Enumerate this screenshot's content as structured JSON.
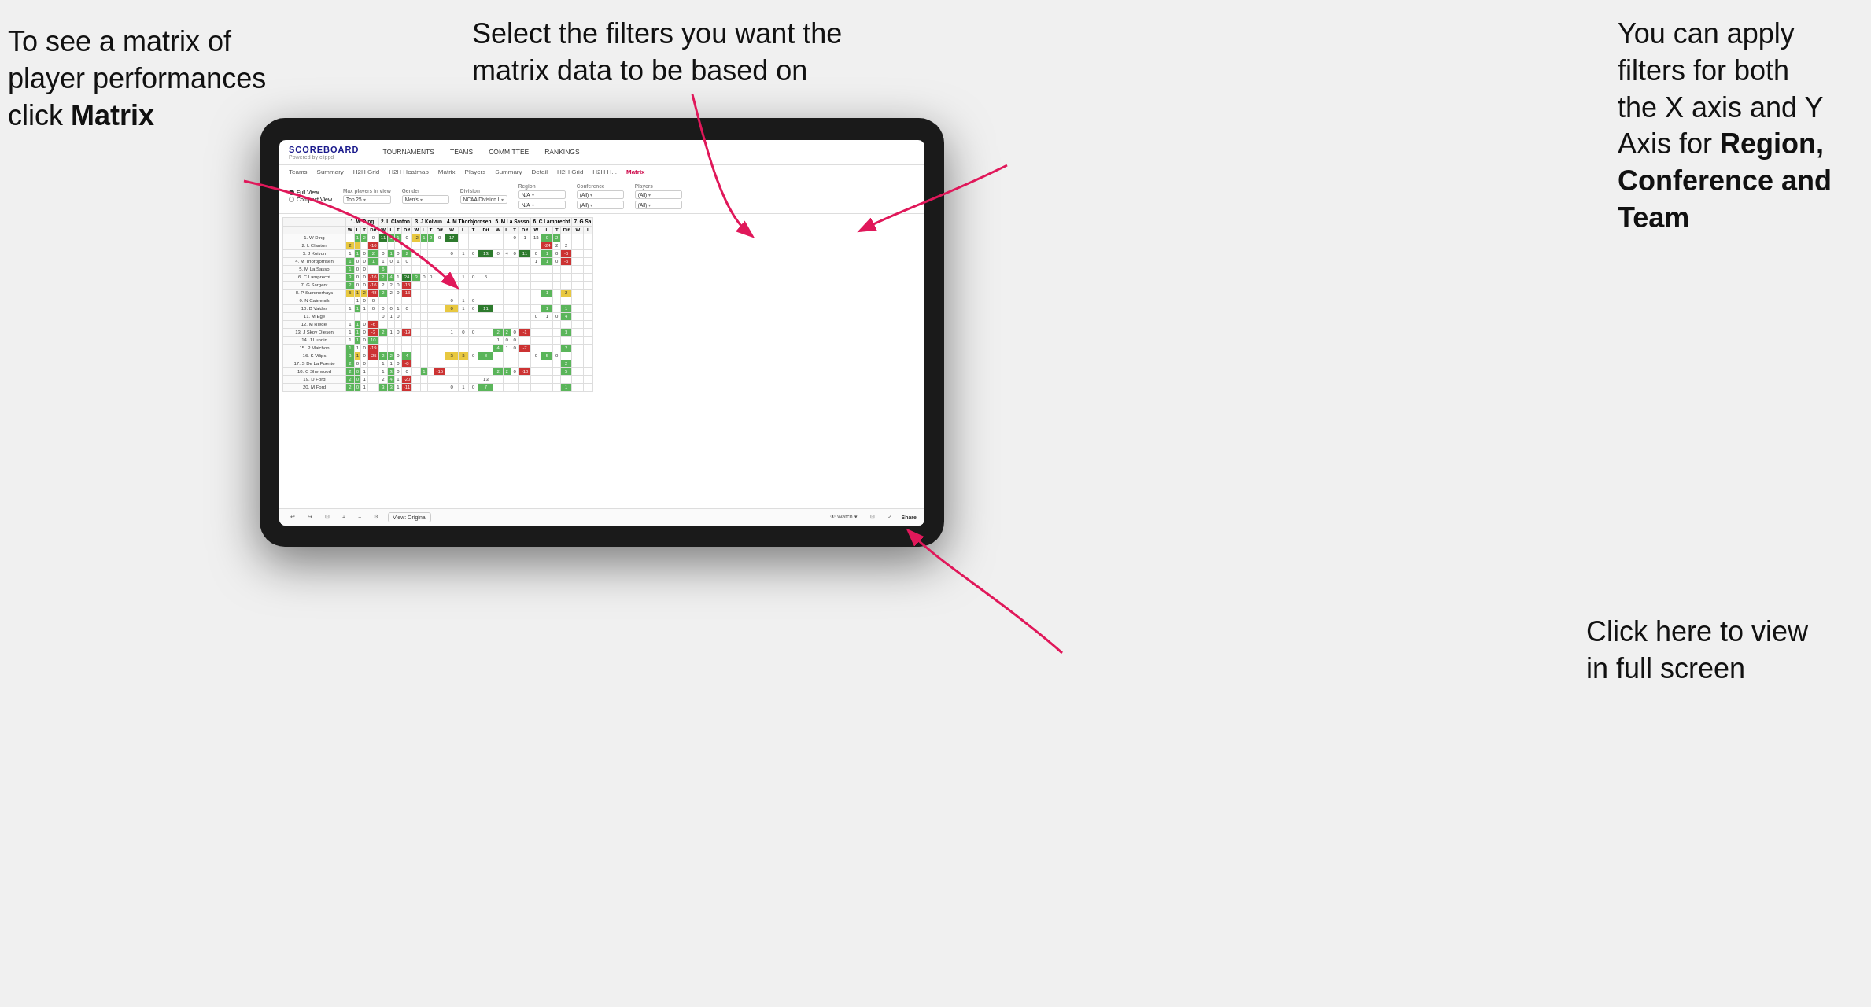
{
  "annotations": {
    "top_left": {
      "line1": "To see a matrix of",
      "line2": "player performances",
      "line3_normal": "click ",
      "line3_bold": "Matrix"
    },
    "top_center": {
      "text": "Select the filters you want the matrix data to be based on"
    },
    "top_right": {
      "line1": "You  can apply",
      "line2": "filters for both",
      "line3": "the X axis and Y",
      "line4_normal": "Axis for ",
      "line4_bold": "Region,",
      "line5_bold": "Conference and",
      "line6_bold": "Team"
    },
    "bottom_right": {
      "line1": "Click here to view",
      "line2": "in full screen"
    }
  },
  "nav": {
    "logo": "SCOREBOARD",
    "logo_sub": "Powered by clippd",
    "items": [
      "TOURNAMENTS",
      "TEAMS",
      "COMMITTEE",
      "RANKINGS"
    ]
  },
  "sub_nav": {
    "items": [
      "Teams",
      "Summary",
      "H2H Grid",
      "H2H Heatmap",
      "Matrix",
      "Players",
      "Summary",
      "Detail",
      "H2H Grid",
      "H2H H...",
      "Matrix"
    ]
  },
  "filters": {
    "view_options": [
      "Full View",
      "Compact View"
    ],
    "max_players_label": "Max players in view",
    "max_players_value": "Top 25",
    "gender_label": "Gender",
    "gender_value": "Men's",
    "division_label": "Division",
    "division_value": "NCAA Division I",
    "region_label": "Region",
    "region_value1": "N/A",
    "region_value2": "N/A",
    "conference_label": "Conference",
    "conference_value1": "(All)",
    "conference_value2": "(All)",
    "players_label": "Players",
    "players_value1": "(All)",
    "players_value2": "(All)"
  },
  "matrix": {
    "col_headers": [
      "1. W Ding",
      "2. L Clanton",
      "3. J Koivun",
      "4. M Thorbjornsen",
      "5. M La Sasso",
      "6. C Lamprecht",
      "7. G Sa"
    ],
    "col_subheaders": [
      "W",
      "L",
      "T",
      "Dif"
    ],
    "rows": [
      {
        "name": "1. W Ding",
        "cells": [
          {
            "type": "white"
          },
          {
            "type": "green",
            "val": "1"
          },
          {
            "type": "green",
            "val": "2"
          },
          {
            "type": "white",
            "val": "0"
          },
          {
            "type": "green-dark",
            "val": "11"
          },
          {
            "type": "green",
            "val": "1"
          },
          {
            "type": "green",
            "val": "1"
          },
          {
            "type": "white",
            "val": "0"
          },
          {
            "type": "yellow",
            "val": "-2"
          },
          {
            "type": "green",
            "val": "1"
          },
          {
            "type": "green",
            "val": "2"
          },
          {
            "type": "white",
            "val": "0"
          },
          {
            "type": "green-dark",
            "val": "17"
          }
        ]
      },
      {
        "name": "2. L Clanton",
        "cells": [
          {
            "type": "yellow"
          },
          {
            "type": "yellow"
          },
          {
            "type": "white",
            "val": "2"
          },
          {
            "type": "red",
            "val": "-16"
          },
          {
            "type": "white"
          },
          {
            "type": "white"
          },
          {
            "type": "white"
          },
          {
            "type": "white"
          },
          {
            "type": "white"
          },
          {
            "type": "white"
          },
          {
            "type": "white"
          },
          {
            "type": "white"
          },
          {
            "type": "white"
          }
        ]
      },
      {
        "name": "3. J Koivun"
      },
      {
        "name": "4. M Thorbjornsen"
      },
      {
        "name": "5. M La Sasso"
      },
      {
        "name": "6. C Lamprecht"
      },
      {
        "name": "7. G Sargent"
      },
      {
        "name": "8. P Summerhays"
      },
      {
        "name": "9. N Gabrelcik"
      },
      {
        "name": "10. B Valdes"
      },
      {
        "name": "11. M Ege"
      },
      {
        "name": "12. M Riedel"
      },
      {
        "name": "13. J Skov Olesen"
      },
      {
        "name": "14. J Lundin"
      },
      {
        "name": "15. P Maichon"
      },
      {
        "name": "16. K Vilips"
      },
      {
        "name": "17. S De La Fuente"
      },
      {
        "name": "18. C Sherwood"
      },
      {
        "name": "19. D Ford"
      },
      {
        "name": "20. M Ford"
      }
    ]
  },
  "toolbar": {
    "view_label": "View: Original",
    "watch_label": "Watch",
    "share_label": "Share"
  }
}
